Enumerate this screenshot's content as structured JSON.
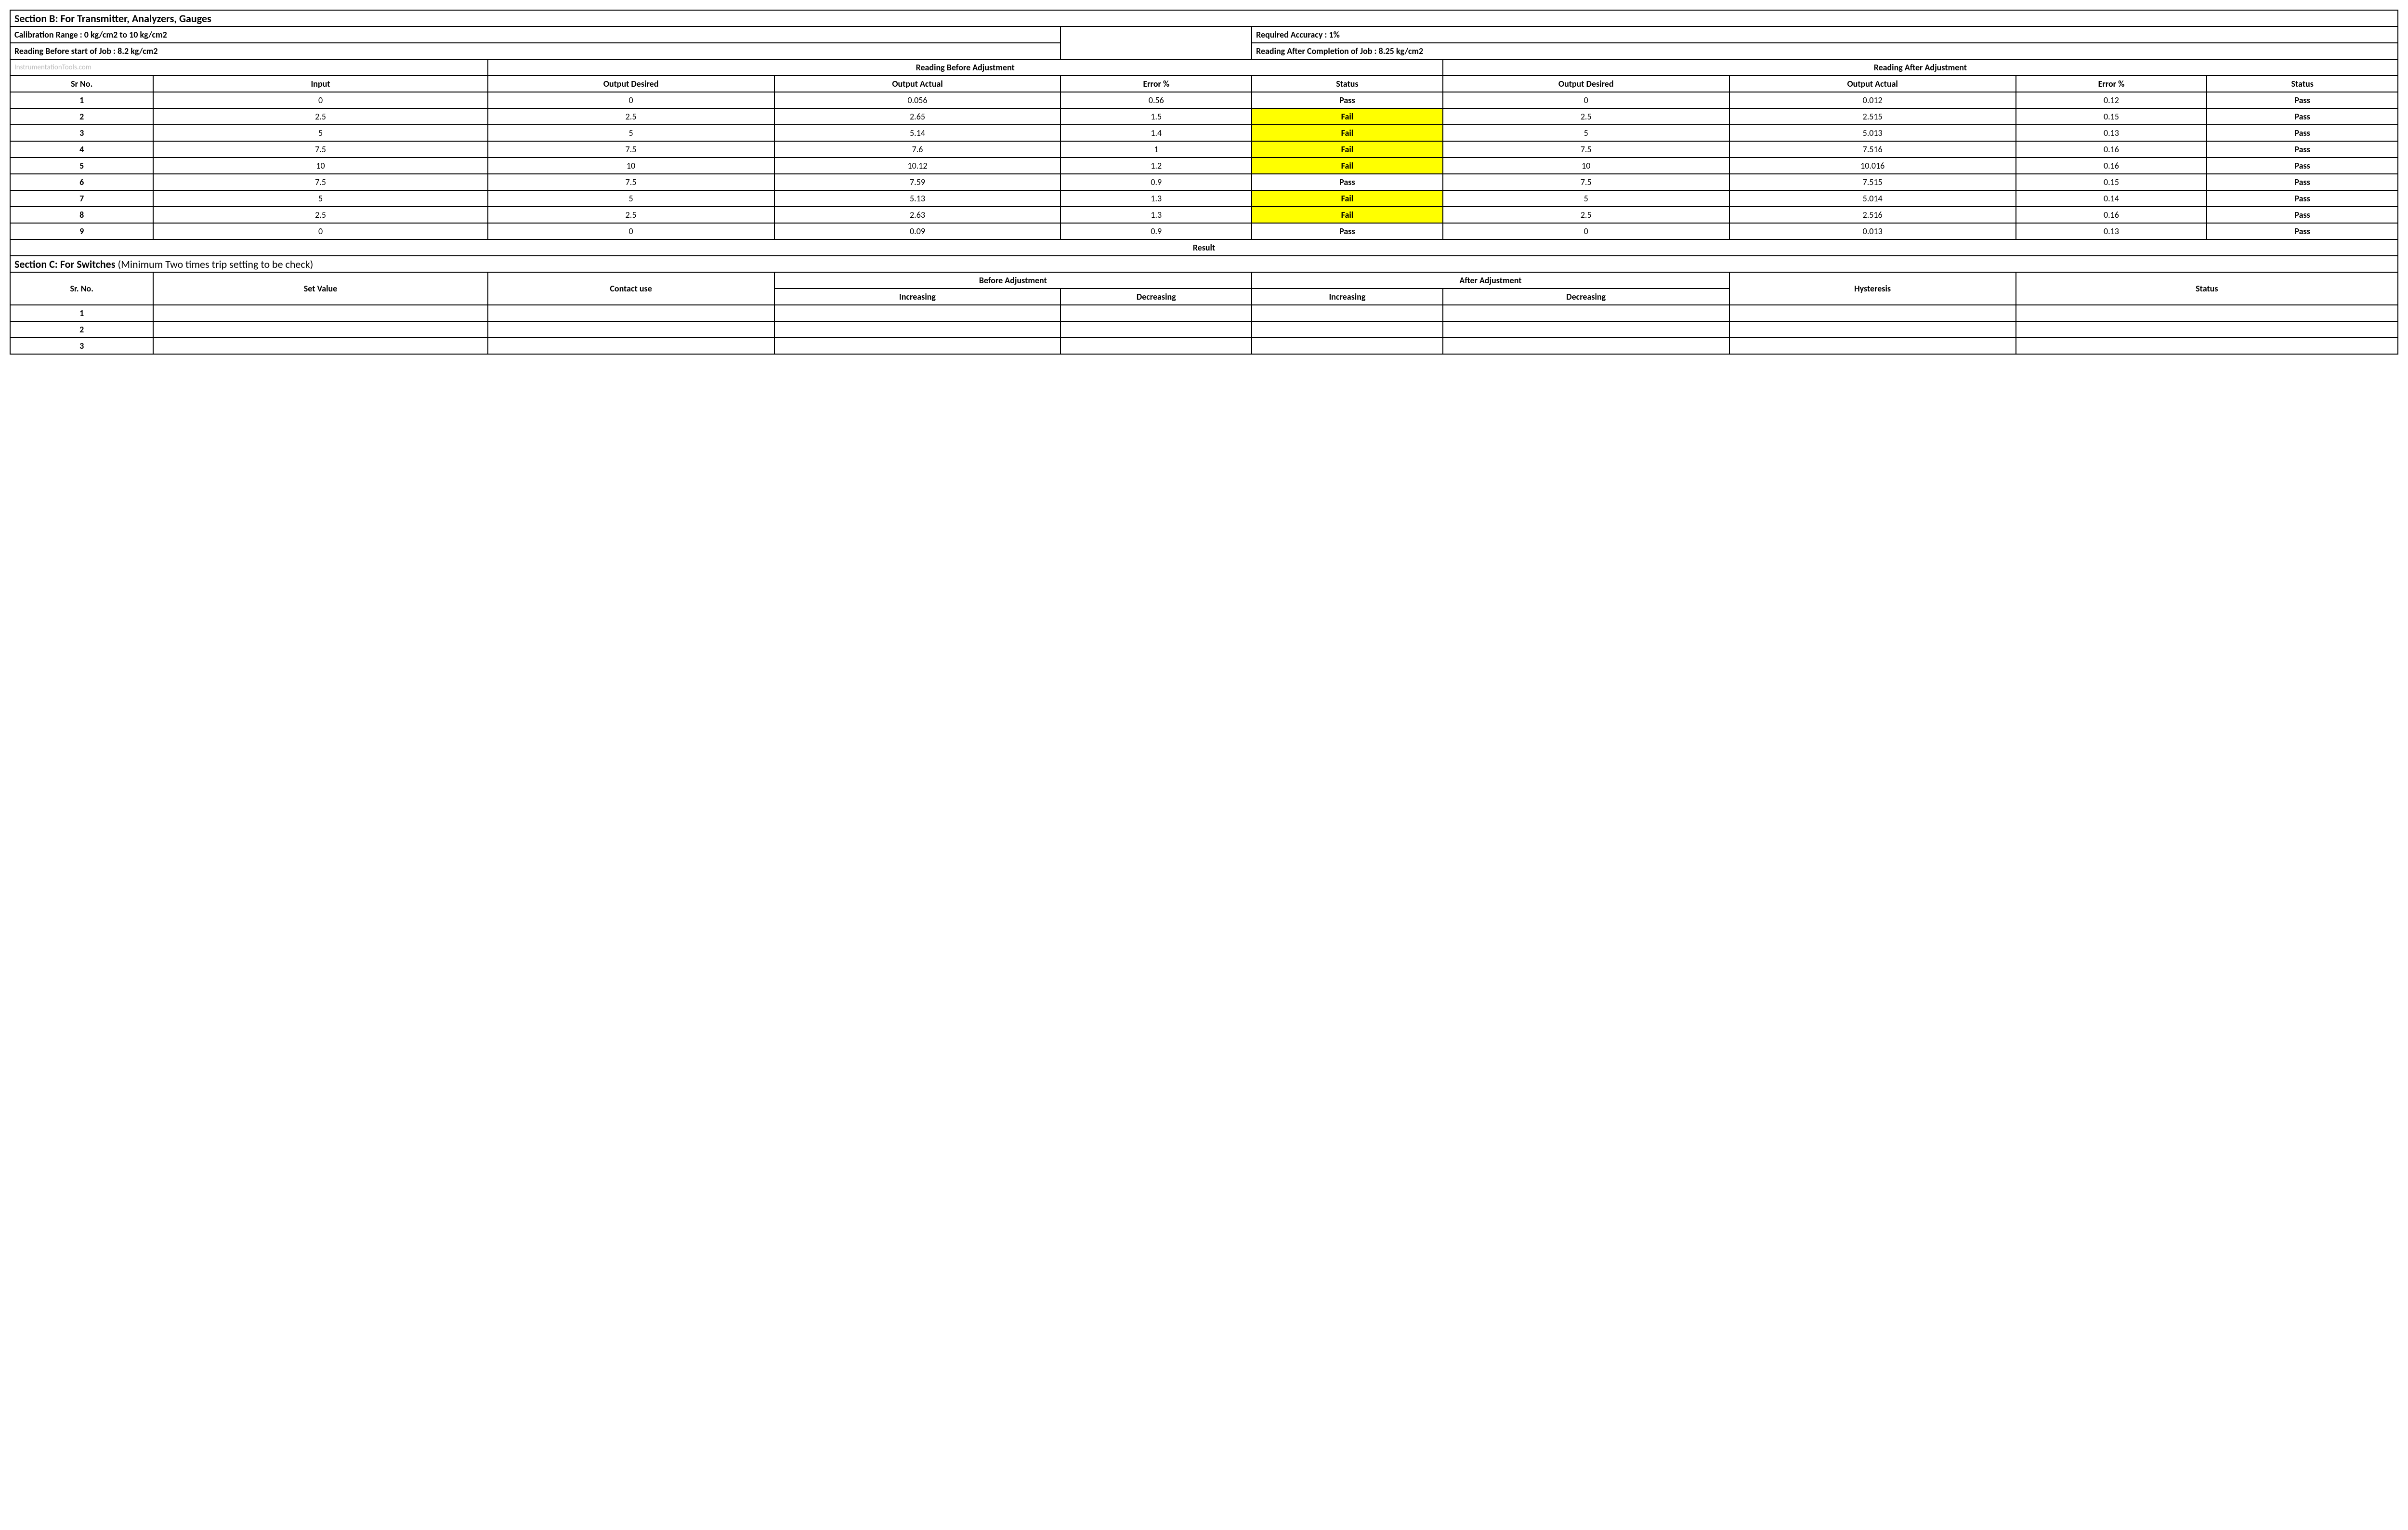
{
  "sectionB": {
    "title": "Section B:  For Transmitter, Analyzers, Gauges",
    "calRange": "Calibration Range : 0 kg/cm2 to 10 kg/cm2",
    "reqAccuracy": "Required Accuracy : 1%",
    "readingBefore": "Reading Before start of Job : 8.2 kg/cm2",
    "readingAfter": "Reading After Completion of Job : 8.25 kg/cm2",
    "watermark": "InstrumentationTools.com",
    "hdrBefore": "Reading Before Adjustment",
    "hdrAfter": "Reading After Adjustment",
    "cols": {
      "sr": "Sr No.",
      "input": "Input",
      "outDesired": "Output Desired",
      "outActual": "Output Actual",
      "err": "Error %",
      "status": "Status"
    },
    "rows": [
      {
        "sr": "1",
        "input": "0",
        "bd": "0",
        "ba": "0.056",
        "be": "0.56",
        "bs": "Pass",
        "ad": "0",
        "aa": "0.012",
        "ae": "0.12",
        "as": "Pass"
      },
      {
        "sr": "2",
        "input": "2.5",
        "bd": "2.5",
        "ba": "2.65",
        "be": "1.5",
        "bs": "Fail",
        "ad": "2.5",
        "aa": "2.515",
        "ae": "0.15",
        "as": "Pass"
      },
      {
        "sr": "3",
        "input": "5",
        "bd": "5",
        "ba": "5.14",
        "be": "1.4",
        "bs": "Fail",
        "ad": "5",
        "aa": "5.013",
        "ae": "0.13",
        "as": "Pass"
      },
      {
        "sr": "4",
        "input": "7.5",
        "bd": "7.5",
        "ba": "7.6",
        "be": "1",
        "bs": "Fail",
        "ad": "7.5",
        "aa": "7.516",
        "ae": "0.16",
        "as": "Pass"
      },
      {
        "sr": "5",
        "input": "10",
        "bd": "10",
        "ba": "10.12",
        "be": "1.2",
        "bs": "Fail",
        "ad": "10",
        "aa": "10.016",
        "ae": "0.16",
        "as": "Pass"
      },
      {
        "sr": "6",
        "input": "7.5",
        "bd": "7.5",
        "ba": "7.59",
        "be": "0.9",
        "bs": "Pass",
        "ad": "7.5",
        "aa": "7.515",
        "ae": "0.15",
        "as": "Pass"
      },
      {
        "sr": "7",
        "input": "5",
        "bd": "5",
        "ba": "5.13",
        "be": "1.3",
        "bs": "Fail",
        "ad": "5",
        "aa": "5.014",
        "ae": "0.14",
        "as": "Pass"
      },
      {
        "sr": "8",
        "input": "2.5",
        "bd": "2.5",
        "ba": "2.63",
        "be": "1.3",
        "bs": "Fail",
        "ad": "2.5",
        "aa": "2.516",
        "ae": "0.16",
        "as": "Pass"
      },
      {
        "sr": "9",
        "input": "0",
        "bd": "0",
        "ba": "0.09",
        "be": "0.9",
        "bs": "Pass",
        "ad": "0",
        "aa": "0.013",
        "ae": "0.13",
        "as": "Pass"
      }
    ],
    "result": "Result"
  },
  "sectionC": {
    "titleBold": "Section C:  For Switches",
    "titleRest": "   (Minimum Two times trip setting to be check)",
    "cols": {
      "sr": "Sr. No.",
      "setVal": "Set Value",
      "contact": "Contact use",
      "before": "Before Adjustment",
      "after": "After Adjustment",
      "inc": "Increasing",
      "dec": "Decreasing",
      "hyst": "Hysteresis",
      "status": "Status"
    },
    "rows": [
      {
        "sr": "1"
      },
      {
        "sr": "2"
      },
      {
        "sr": "3"
      }
    ]
  }
}
